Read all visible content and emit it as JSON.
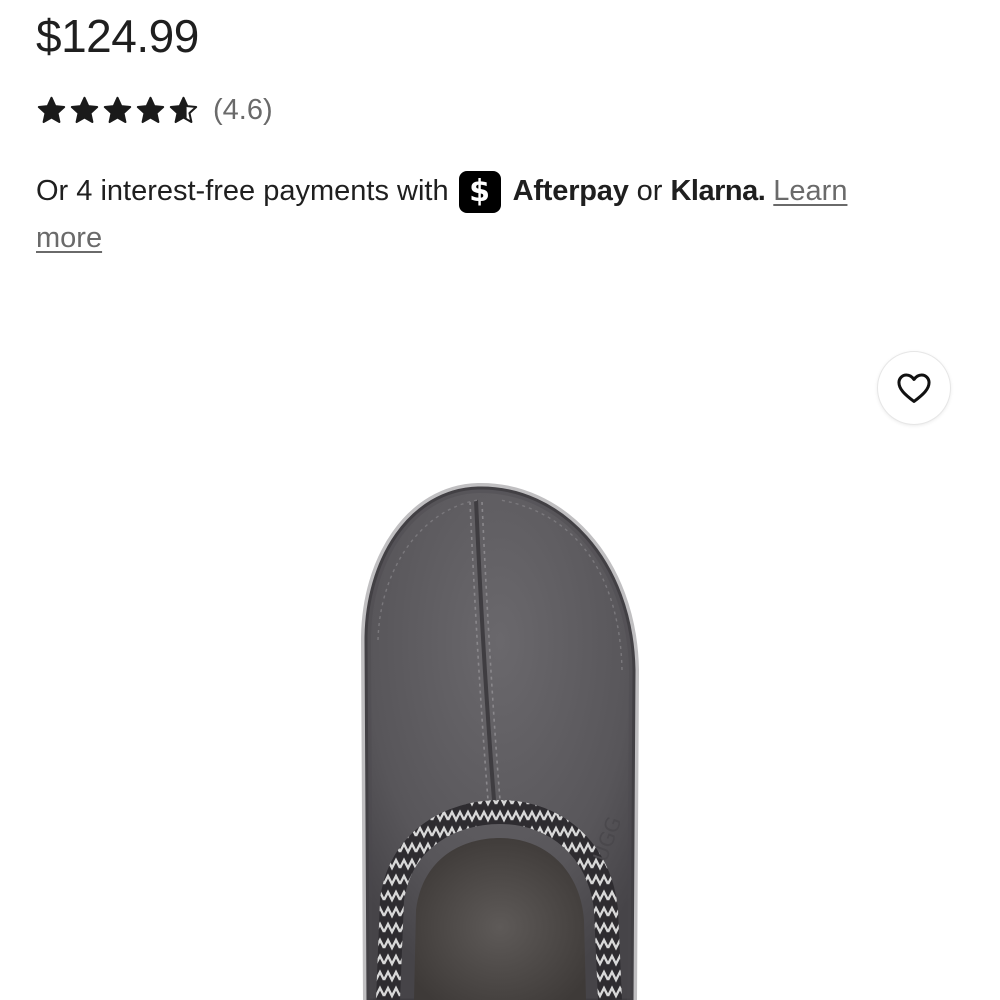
{
  "product": {
    "price": "$124.99",
    "rating": {
      "value": 4.6,
      "max": 5,
      "label": "(4.6)"
    }
  },
  "payments": {
    "prefix": "Or 4 interest-free payments with",
    "afterpay_icon": "$",
    "afterpay_label": "Afterpay",
    "or": "or",
    "klarna_label": "Klarna.",
    "link_word1": "Learn",
    "link_word2": "more"
  },
  "wishlist": {
    "icon": "heart-outline-icon"
  },
  "image": {
    "subject": "grey suede slipper top view"
  },
  "colors": {
    "star": "#1a1a1a",
    "text": "#1f1f1f",
    "muted": "#6a6a6a",
    "slipper": "#5a585c",
    "badge": "#000000"
  }
}
